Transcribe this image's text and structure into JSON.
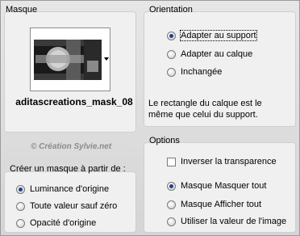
{
  "mask_section": {
    "legend": "Masque",
    "mask_name": "aditascreations_mask_08",
    "watermark": "© Création Sylvie.net"
  },
  "create_section": {
    "legend": "Créer un masque à partir de :",
    "options": [
      {
        "label": "Luminance d'origine",
        "selected": true
      },
      {
        "label": "Toute valeur sauf zéro",
        "selected": false
      },
      {
        "label": "Opacité d'origine",
        "selected": false
      }
    ]
  },
  "orientation_section": {
    "legend": "Orientation",
    "options": [
      {
        "label": "Adapter au support",
        "selected": true
      },
      {
        "label": "Adapter au calque",
        "selected": false
      },
      {
        "label": "Inchangée",
        "selected": false
      }
    ],
    "note": "Le rectangle du calque est le même que celui du support."
  },
  "options_section": {
    "legend": "Options",
    "invert_label": "Inverser la transparence",
    "invert_checked": false,
    "options": [
      {
        "label": "Masque Masquer tout",
        "selected": true
      },
      {
        "label": "Masque Afficher tout",
        "selected": false
      },
      {
        "label": "Utiliser la valeur de l'image",
        "selected": false
      }
    ]
  },
  "colors": {
    "radio_dot": "#1f3f8a",
    "panel_bg": "#f0f0f0"
  }
}
